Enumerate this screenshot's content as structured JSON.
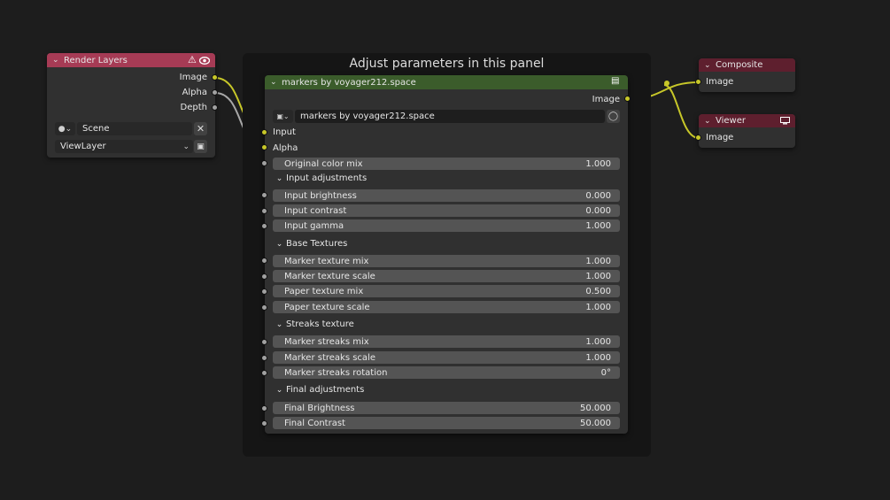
{
  "frame": {
    "title": "Adjust parameters in this panel"
  },
  "render_layers": {
    "title": "Render Layers",
    "outputs": [
      "Image",
      "Alpha",
      "Depth"
    ],
    "scene_value": "Scene",
    "view_layer_value": "ViewLayer"
  },
  "group_node": {
    "title": "markers by voyager212.space",
    "output_label": "Image",
    "datablock_name": "markers by voyager212.space",
    "inputs": [
      "Input",
      "Alpha"
    ],
    "top_fields": [
      {
        "label": "Original color mix",
        "value": "1.000"
      }
    ],
    "sections": [
      {
        "title": "Input adjustments",
        "fields": [
          {
            "label": "Input brightness",
            "value": "0.000"
          },
          {
            "label": "Input contrast",
            "value": "0.000"
          },
          {
            "label": "Input gamma",
            "value": "1.000"
          }
        ]
      },
      {
        "title": "Base Textures",
        "fields": [
          {
            "label": "Marker texture mix",
            "value": "1.000"
          },
          {
            "label": "Marker texture scale",
            "value": "1.000"
          },
          {
            "label": "Paper texture mix",
            "value": "0.500"
          },
          {
            "label": "Paper texture scale",
            "value": "1.000"
          }
        ]
      },
      {
        "title": "Streaks texture",
        "fields": [
          {
            "label": "Marker streaks mix",
            "value": "1.000"
          },
          {
            "label": "Marker streaks scale",
            "value": "1.000"
          },
          {
            "label": "Marker streaks rotation",
            "value": "0°"
          }
        ]
      },
      {
        "title": "Final adjustments",
        "fields": [
          {
            "label": "Final Brightness",
            "value": "50.000"
          },
          {
            "label": "Final Contrast",
            "value": "50.000"
          }
        ]
      }
    ]
  },
  "composite": {
    "title": "Composite",
    "input_label": "Image"
  },
  "viewer": {
    "title": "Viewer",
    "input_label": "Image"
  },
  "colors": {
    "background": "#1d1d1d",
    "node_body": "#303030",
    "render_layers_header": "#a63b55",
    "group_header": "#3b5c2b",
    "output_header": "#5e1f2e",
    "socket_color": "#c7c729",
    "socket_value": "#a1a1a1",
    "field_bg": "#545454",
    "link": "#c7c729"
  },
  "icons": {
    "header_warning": "warning-icon",
    "header_visibility": "eye-icon",
    "scene_selector": "scene-icon",
    "clear": "x-icon",
    "browse": "browse-layer-icon",
    "group_node": "node-tree-icon",
    "fake_user": "shield-icon",
    "viewer_display": "monitor-icon"
  }
}
